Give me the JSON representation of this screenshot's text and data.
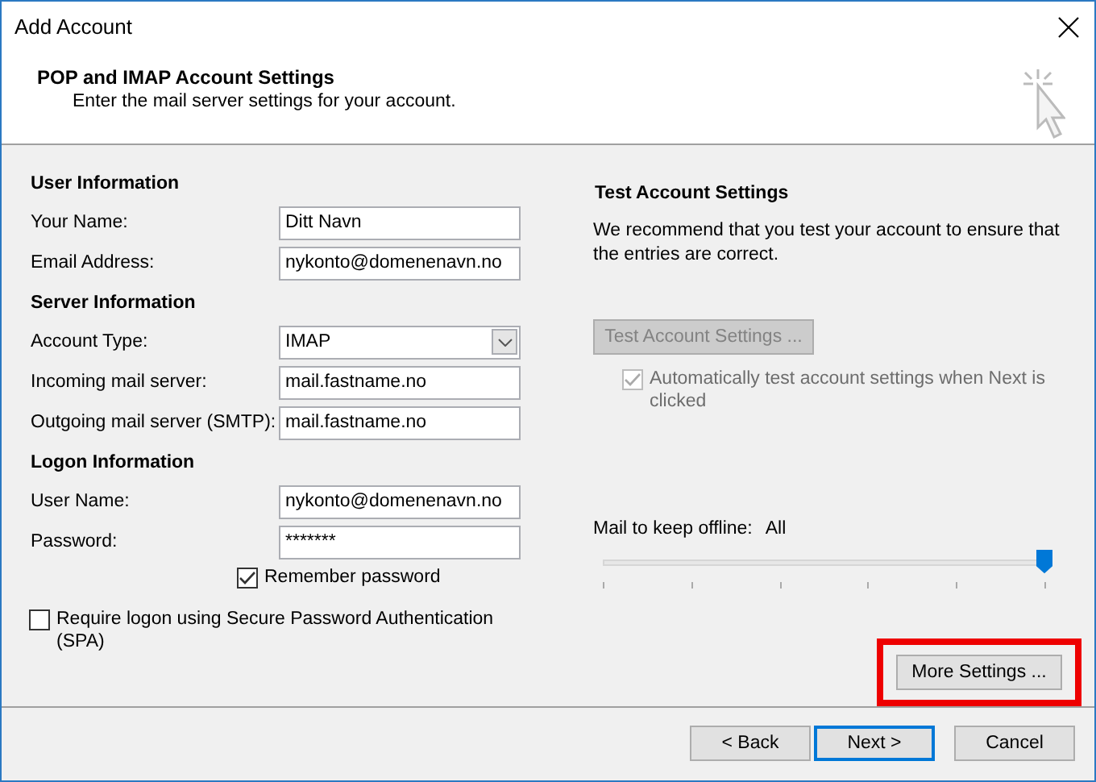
{
  "window": {
    "title": "Add Account"
  },
  "header": {
    "title": "POP and IMAP Account Settings",
    "subtitle": "Enter the mail server settings for your account."
  },
  "sections": [
    {
      "title": "User Information",
      "fields": [
        {
          "label": "Your Name:",
          "kind": "text",
          "value": "Ditt Navn"
        },
        {
          "label": "Email Address:",
          "kind": "text",
          "value": "nykonto@domenenavn.no"
        }
      ]
    },
    {
      "title": "Server Information",
      "fields": [
        {
          "label": "Account Type:",
          "kind": "select",
          "value": "IMAP"
        },
        {
          "label": "Incoming mail server:",
          "kind": "text",
          "value": "mail.fastname.no"
        },
        {
          "label": "Outgoing mail server (SMTP):",
          "kind": "text",
          "value": "mail.fastname.no"
        }
      ]
    },
    {
      "title": "Logon Information",
      "fields": [
        {
          "label": "User Name:",
          "kind": "text",
          "value": "nykonto@domenenavn.no"
        },
        {
          "label": "Password:",
          "kind": "password",
          "value": "*******"
        }
      ]
    }
  ],
  "remember_password": {
    "label": "Remember password",
    "checked": true
  },
  "require_spa": {
    "label": "Require logon using Secure Password Authentication (SPA)",
    "checked": false
  },
  "test": {
    "title": "Test Account Settings",
    "description": "We recommend that you test your account to ensure that the entries are correct.",
    "button": {
      "label": "Test Account Settings ...",
      "disabled": true
    },
    "auto_test": {
      "label": "Automatically test account settings when Next is clicked",
      "checked": true,
      "disabled": true
    }
  },
  "offline": {
    "label": "Mail to keep offline:",
    "value": "All",
    "level": 1
  },
  "more_settings": {
    "label": "More Settings ...",
    "highlighted": true
  },
  "buttons": [
    {
      "label": "< Back",
      "default": false
    },
    {
      "label": "Next >",
      "default": true
    },
    {
      "label": "Cancel",
      "default": false
    }
  ]
}
